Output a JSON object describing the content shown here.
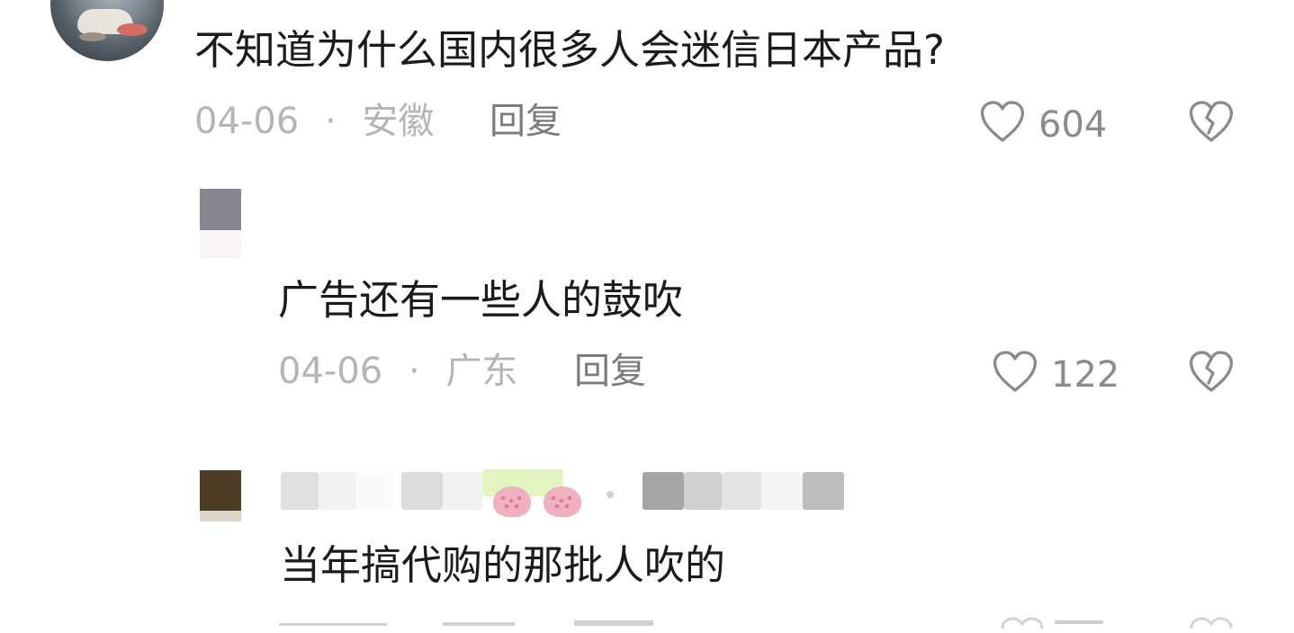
{
  "comments": [
    {
      "text": "不知道为什么国内很多人会迷信日本产品?",
      "date": "04-06",
      "location": "安徽",
      "reply_label": "回复",
      "likes": "604"
    },
    {
      "text": "广告还有一些人的鼓吹",
      "date": "04-06",
      "location": "广东",
      "reply_label": "回复",
      "likes": "122"
    },
    {
      "text": "当年搞代购的那批人吹的"
    }
  ],
  "colors": {
    "primary_text": "#1b1b1b",
    "meta_text": "#b5b5b5",
    "reply_text": "#7b7b7b",
    "icon_gray": "#8b8b8b"
  },
  "icons": {
    "like": "heart-icon",
    "dislike": "broken-heart-icon",
    "strawberry": "strawberry-icon"
  }
}
